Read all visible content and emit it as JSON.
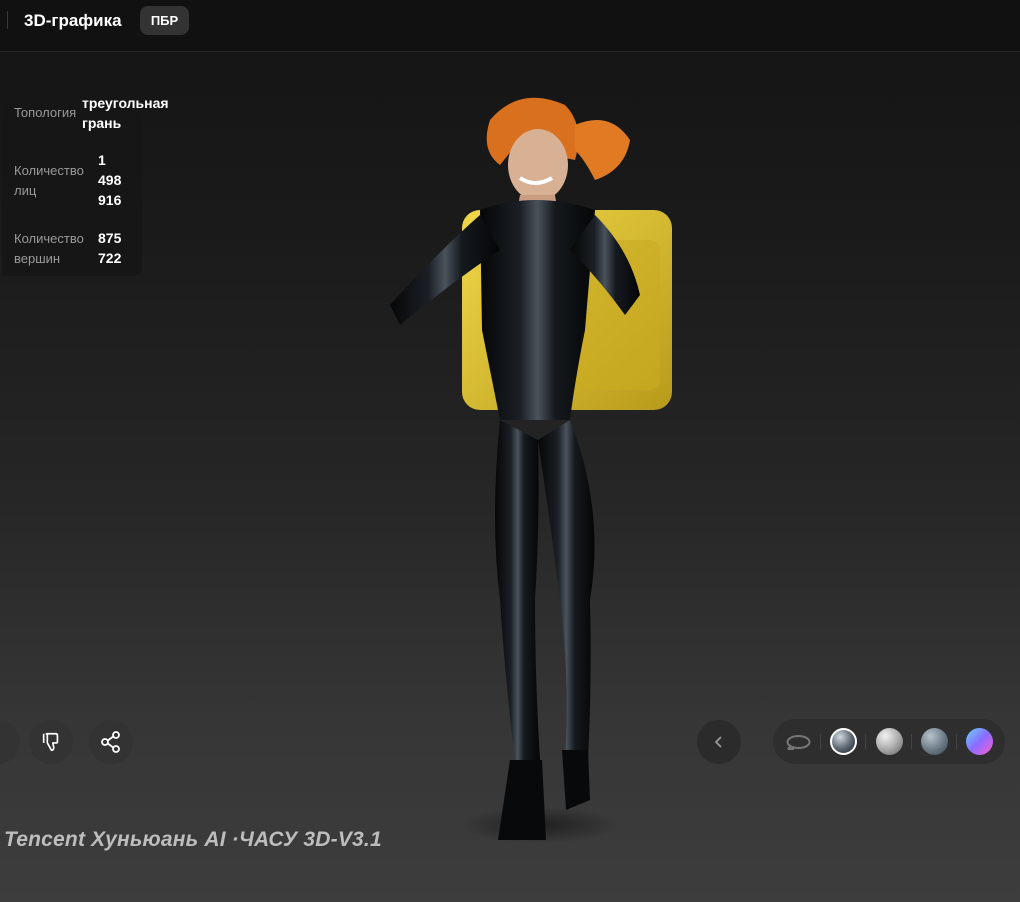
{
  "header": {
    "title": "3D-графика",
    "badge": "ПБР"
  },
  "stats": {
    "topology_label": "Топология",
    "topology_value_lines": [
      "треугольная",
      "грань"
    ],
    "faces_label_lines": [
      "Количество",
      "лиц"
    ],
    "faces_value_lines": [
      "1",
      "498",
      "916"
    ],
    "vertices_label_lines": [
      "Количество",
      "вершин"
    ],
    "vertices_value_lines": [
      "875",
      "722"
    ]
  },
  "actions": {
    "left_partial_icon": "partial-button",
    "dislike_icon": "thumbs-down-icon",
    "share_icon": "share-icon",
    "prev_icon": "chevron-left-icon"
  },
  "render_modes": {
    "rotate_icon": "rotate-icon",
    "modes": [
      "pbr-material",
      "white-clay",
      "texture",
      "normal-map"
    ],
    "selected": "pbr-material"
  },
  "watermark": "Tencent Хуньюань AI ·ЧАСУ 3D-V3.1",
  "colors": {
    "background": "#1a1a1a",
    "accent_yellow": "#e8c829"
  }
}
